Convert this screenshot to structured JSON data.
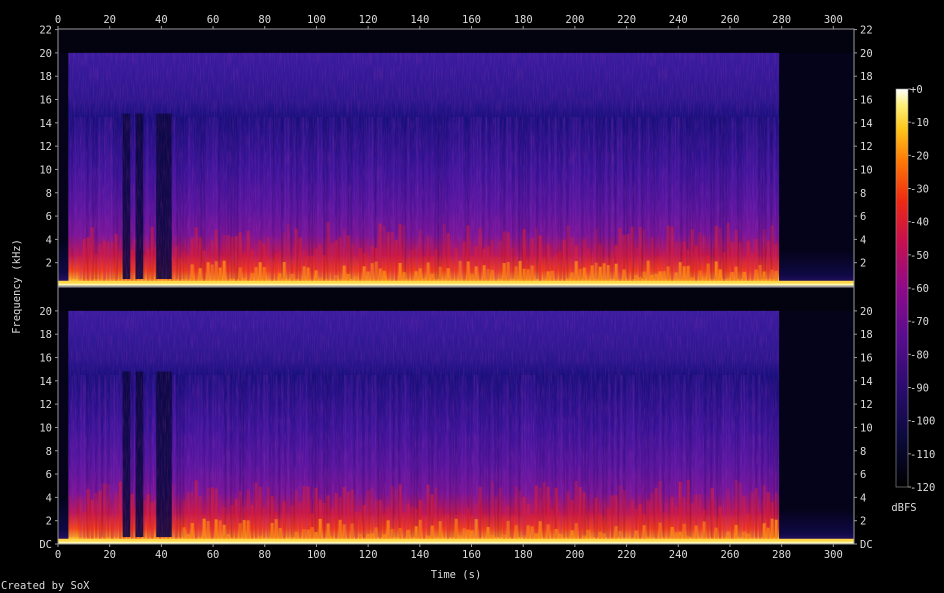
{
  "credit": "Created by SoX",
  "colors": {
    "background": "#000000",
    "text": "#dcdcdc",
    "frame": "#9a9a9a"
  },
  "chart_data": {
    "type": "heatmap",
    "subtype": "spectrogram",
    "channels": 2,
    "xlabel": "Time (s)",
    "ylabel": "Frequency (kHz)",
    "xlim": [
      0,
      308
    ],
    "ylim": [
      0,
      22.05
    ],
    "x_ticks": [
      "0",
      "20",
      "40",
      "60",
      "80",
      "100",
      "120",
      "140",
      "160",
      "180",
      "200",
      "220",
      "240",
      "260",
      "280",
      "300"
    ],
    "y_ticks_top_channel": [
      "2",
      "4",
      "6",
      "8",
      "10",
      "12",
      "14",
      "16",
      "18",
      "20",
      "22"
    ],
    "y_ticks_bottom_channel": [
      "DC",
      "2",
      "4",
      "6",
      "8",
      "10",
      "12",
      "14",
      "16",
      "18",
      "20"
    ],
    "lowpass_cutoff_khz": 20,
    "audio_start_s": 4,
    "audio_end_s": 279,
    "quiet_gaps_s": [
      [
        25,
        28
      ],
      [
        30,
        33
      ],
      [
        38,
        44
      ]
    ],
    "colorbar": {
      "label": "dBFS",
      "range": [
        -120,
        0
      ],
      "ticks": [
        "+0",
        "-10",
        "-20",
        "-30",
        "-40",
        "-50",
        "-60",
        "-70",
        "-80",
        "-90",
        "-100",
        "-110",
        "-120"
      ]
    }
  }
}
